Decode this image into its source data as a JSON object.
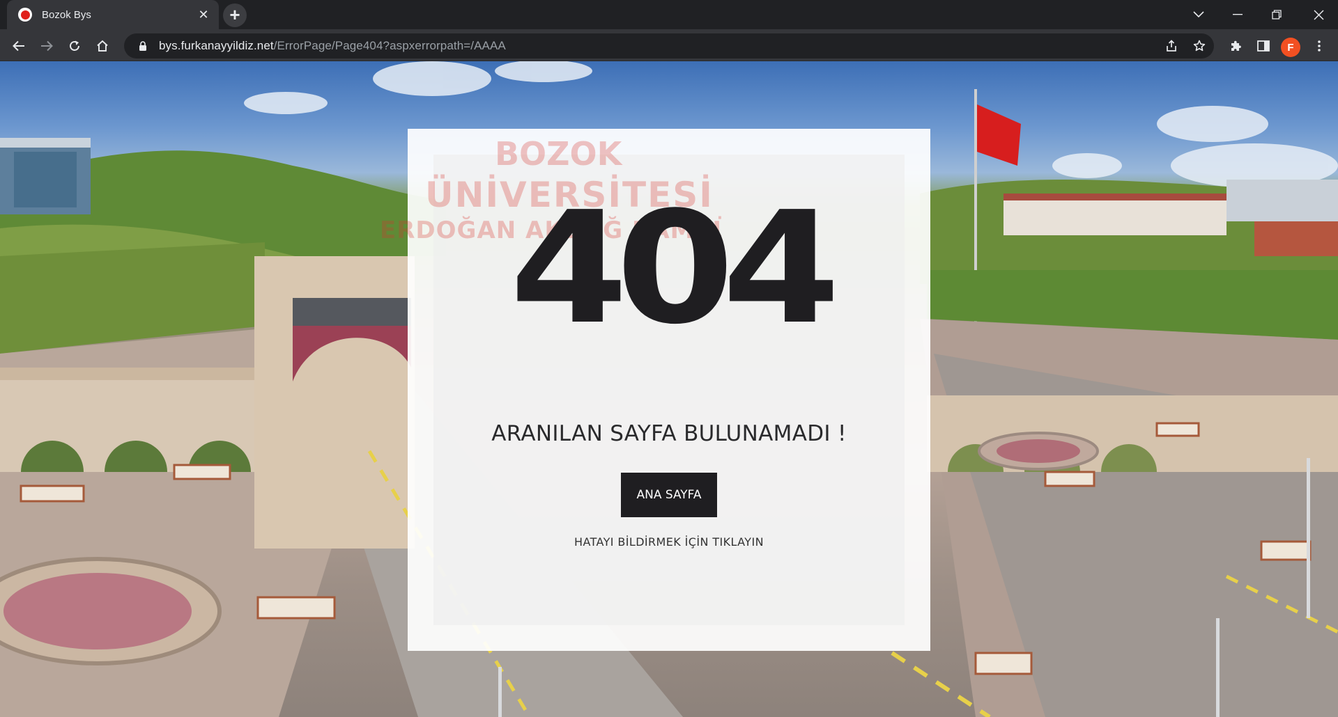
{
  "browser": {
    "tab": {
      "title": "Bozok Bys",
      "favicon": "opera-like-red-circle-icon",
      "close_glyph": "✕"
    },
    "new_tab_glyph": "+",
    "window_controls": {
      "tab_search_glyph": "⌄",
      "minimize_glyph": "—",
      "restore_glyph": "❐",
      "close_glyph": "✕"
    },
    "address_bar": {
      "host": "bys.furkanayyildiz.net",
      "path": "/ErrorPage/Page404?aspxerrorpath=/AAAA"
    },
    "profile_initial": "F",
    "profile_color": "#f25022"
  },
  "page": {
    "background_description_colors": {
      "sky": "#5b86c4",
      "hills": "#6f8f3f",
      "plaza": "#b4a196"
    },
    "error_code": "404",
    "message": "ARANILAN SAYFA BULUNAMADI !",
    "home_button_label": "ANA SAYFA",
    "report_link_label": "HATAYI BİLDİRMEK İÇİN TIKLAYIN",
    "watermark": {
      "line1": "BOZOK",
      "line2": "ÜNİVERSİTESİ",
      "line3": "ERDOĞAN AKDAĞ KAMPÜSÜ",
      "color": "#d8342c"
    }
  }
}
